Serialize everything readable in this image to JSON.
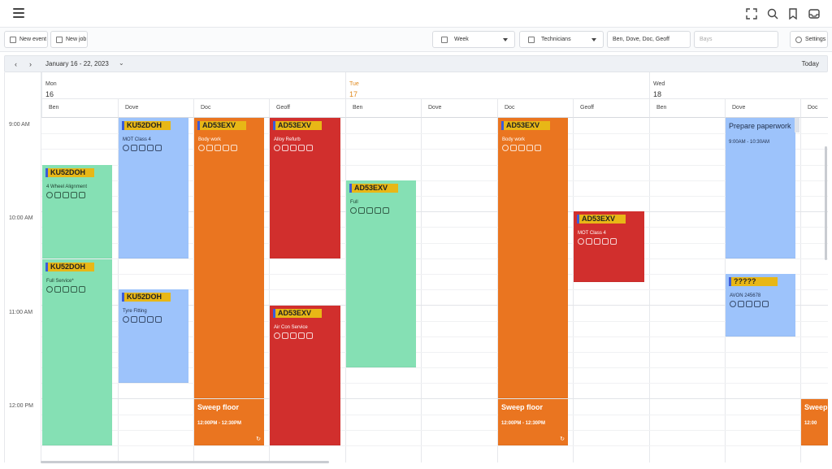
{
  "toolbar": {
    "new_event": "New event",
    "new_job": "New job",
    "view": "Week",
    "group_by": "Technicians",
    "technicians": "Ben, Dove, Doc, Geoff",
    "bays_placeholder": "Bays",
    "settings": "Settings"
  },
  "datebar": {
    "prev": "‹",
    "next": "›",
    "range": "January 16 - 22, 2023",
    "today": "Today"
  },
  "times": [
    "9:00 AM",
    "10:00 AM",
    "11:00 AM",
    "12:00 PM"
  ],
  "days": [
    {
      "name": "Mon",
      "num": "16"
    },
    {
      "name": "Tue",
      "num": "17"
    },
    {
      "name": "Wed",
      "num": "18"
    }
  ],
  "columns": [
    "Ben",
    "Dove",
    "Doc",
    "Geoff",
    "Ben",
    "Dove",
    "Doc",
    "Geoff",
    "Ben",
    "Dove",
    "Doc"
  ],
  "events": {
    "ev1": {
      "reg": "KU52DOH",
      "title": "MOT Class 4",
      "color": "#9dc3fb"
    },
    "ev2": {
      "reg": "AD53EXV",
      "title": "Body work",
      "color": "#ea7520"
    },
    "ev3": {
      "reg": "AD53EXV",
      "title": "Alloy Refurb",
      "color": "#d12f2d"
    },
    "ev4": {
      "reg": "KU52DOH",
      "title": "4 Wheel Alignment",
      "color": "#85e0b4"
    },
    "ev5": {
      "reg": "KU52DOH",
      "title": "Full Service*",
      "color": "#85e0b4"
    },
    "ev6": {
      "reg": "KU52DOH",
      "title": "Tyre Fitting",
      "color": "#9dc3fb"
    },
    "ev7": {
      "reg": "AD53EXV",
      "title": "Air Con Service",
      "color": "#d12f2d"
    },
    "ev8": {
      "reg": "AD53EXV",
      "title": "Full",
      "color": "#85e0b4"
    },
    "ev9": {
      "reg": "AD53EXV",
      "title": "Body work",
      "color": "#ea7520"
    },
    "ev10": {
      "reg": "AD53EXV",
      "title": "MOT Class 4",
      "color": "#d12f2d"
    },
    "ev11": {
      "reg": "?????",
      "title": "AVON 245678",
      "color": "#9dc3fb"
    },
    "ev12": {
      "title": "Prepare paperwork",
      "time": "9:00AM - 10:30AM",
      "color": "#9dc3fb"
    },
    "sweep1": {
      "title": "Sweep floor",
      "time": "12:00PM - 12:30PM",
      "color": "#ea7520"
    },
    "sweep2": {
      "title": "Sweep floor",
      "time": "12:00PM - 12:30PM",
      "color": "#ea7520"
    },
    "sweep3": {
      "title": "Sweep",
      "time": "12:00",
      "color": "#ea7520"
    }
  }
}
